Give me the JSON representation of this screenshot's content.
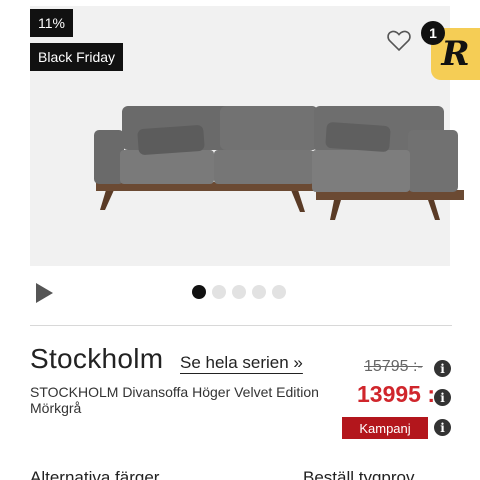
{
  "badges": {
    "discount": "11%",
    "campaign": "Black Friday"
  },
  "retailer_badge": {
    "count": "1",
    "letter": "R"
  },
  "gallery": {
    "dots_count": 5,
    "active_index": 0
  },
  "product": {
    "name": "Stockholm",
    "series_link": "Se hela serien »",
    "description": "STOCKHOLM Divansoffa Höger Velvet Edition Mörkgrå",
    "old_price": "15795 :-",
    "price": "13995 :-",
    "campaign_label": "Kampanj",
    "info_glyph": "i"
  },
  "bottom": {
    "alt_colors": "Alternativa färger",
    "order_sample": "Beställ tygprov",
    "arrow": "→"
  },
  "colors": {
    "price_red": "#d0262c",
    "campaign_red": "#b3161c",
    "retailer_yellow": "#f5cd55"
  }
}
